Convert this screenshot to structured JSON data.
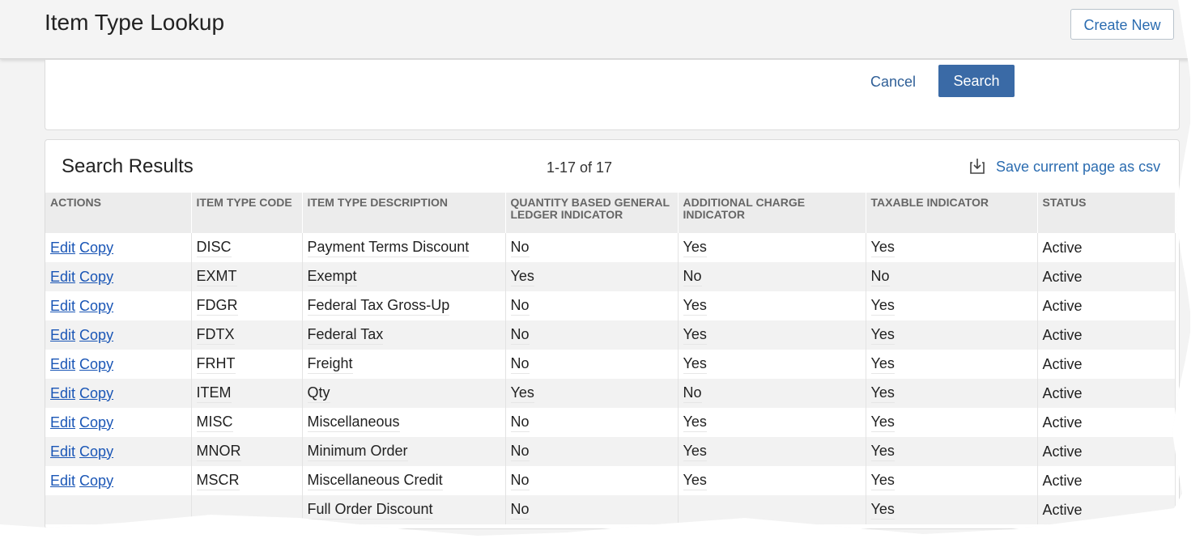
{
  "header": {
    "title": "Item Type Lookup",
    "create_label": "Create New"
  },
  "search_panel": {
    "cancel_label": "Cancel",
    "search_label": "Search"
  },
  "results": {
    "title": "Search Results",
    "paging": "1-17 of 17",
    "csv_label": "Save current page as csv",
    "csv_icon": "download-icon",
    "columns": [
      "ACTIONS",
      "ITEM TYPE CODE",
      "ITEM TYPE DESCRIPTION",
      "QUANTITY BASED GENERAL LEDGER INDICATOR",
      "ADDITIONAL CHARGE INDICATOR",
      "TAXABLE INDICATOR",
      "STATUS"
    ],
    "edit_label": "Edit",
    "copy_label": "Copy",
    "rows": [
      [
        "DISC",
        "Payment Terms Discount",
        "No",
        "Yes",
        "Yes",
        "Active"
      ],
      [
        "EXMT",
        "Exempt",
        "Yes",
        "No",
        "No",
        "Active"
      ],
      [
        "FDGR",
        "Federal Tax Gross-Up",
        "No",
        "Yes",
        "Yes",
        "Active"
      ],
      [
        "FDTX",
        "Federal Tax",
        "No",
        "Yes",
        "Yes",
        "Active"
      ],
      [
        "FRHT",
        "Freight",
        "No",
        "Yes",
        "Yes",
        "Active"
      ],
      [
        "ITEM",
        "Qty",
        "Yes",
        "No",
        "Yes",
        "Active"
      ],
      [
        "MISC",
        "Miscellaneous",
        "No",
        "Yes",
        "Yes",
        "Active"
      ],
      [
        "MNOR",
        "Minimum Order",
        "No",
        "Yes",
        "Yes",
        "Active"
      ],
      [
        "MSCR",
        "Miscellaneous Credit",
        "No",
        "Yes",
        "Yes",
        "Active"
      ],
      [
        "",
        "Full Order Discount",
        "No",
        "",
        "Yes",
        "Active"
      ]
    ]
  },
  "colors": {
    "primary_button": "#3a6aa6",
    "link": "#1a56b6",
    "header_bg": "#ececec"
  }
}
